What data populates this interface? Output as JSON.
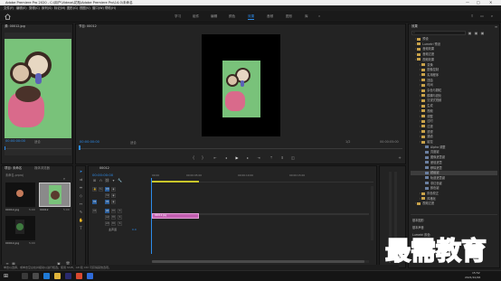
{
  "app": {
    "title": "Adobe Premiere Pro 2020 - C:\\用户\\Videos\\花瓶\\Adobe Premiere Pro\\14.0\\未命名",
    "window_controls": [
      "—",
      "□",
      "✕"
    ]
  },
  "menu": [
    "文件(F)",
    "编辑(E)",
    "剪辑(C)",
    "序列(S)",
    "标记(M)",
    "图形(G)",
    "视图(V)",
    "窗口(W)",
    "帮助(H)"
  ],
  "workspaces": {
    "home_icon": "home-icon",
    "tabs": [
      "学习",
      "组件",
      "编辑",
      "颜色",
      "效果",
      "音频",
      "图形",
      "库"
    ],
    "active": "效果"
  },
  "source_monitor": {
    "tab": "源: 00012.jpg",
    "timecode": "00:00:00:00",
    "zoom": "适合"
  },
  "program_monitor": {
    "tab": "节目: 00012",
    "timecode": "00:00:00:00",
    "zoom": "适合",
    "quality": "1/2",
    "duration": "00:00:05:00"
  },
  "project_panel": {
    "tab": "项目: 未命名",
    "tab2": "媒体浏览器",
    "project_file": "未命名.prproj",
    "items": [
      {
        "name": "00012.jpg",
        "meta": "5:00"
      },
      {
        "name": "00012",
        "meta": "5:00"
      },
      {
        "name": "00012.jpg",
        "meta": "5:00"
      }
    ]
  },
  "timeline": {
    "tab": "00012",
    "timecode": "00:00:00:00",
    "ruler": [
      "00:00",
      "00:00:05:00",
      "00:00:10:00",
      "00:00:15:00"
    ],
    "video_tracks": [
      "V3",
      "V2",
      "V1"
    ],
    "audio_tracks": [
      "A1",
      "A2",
      "A3"
    ],
    "master": "主声道",
    "master_value": "0.0",
    "clip": "00012.jpg"
  },
  "effects_panel": {
    "tab": "效果",
    "tree": [
      {
        "label": "预设",
        "indent": 1,
        "kind": "folder"
      },
      {
        "label": "Lumetri 预设",
        "indent": 1,
        "kind": "folder"
      },
      {
        "label": "音频效果",
        "indent": 1,
        "kind": "folder"
      },
      {
        "label": "音频过渡",
        "indent": 1,
        "kind": "folder"
      },
      {
        "label": "视频效果",
        "indent": 1,
        "kind": "folder"
      },
      {
        "label": "变换",
        "indent": 2,
        "kind": "folder"
      },
      {
        "label": "图像控制",
        "indent": 2,
        "kind": "folder"
      },
      {
        "label": "实用程序",
        "indent": 2,
        "kind": "folder"
      },
      {
        "label": "扭曲",
        "indent": 2,
        "kind": "folder"
      },
      {
        "label": "时间",
        "indent": 2,
        "kind": "folder"
      },
      {
        "label": "杂色与颗粒",
        "indent": 2,
        "kind": "folder"
      },
      {
        "label": "模糊与锐化",
        "indent": 2,
        "kind": "folder"
      },
      {
        "label": "沉浸式视频",
        "indent": 2,
        "kind": "folder"
      },
      {
        "label": "生成",
        "indent": 2,
        "kind": "folder"
      },
      {
        "label": "视频",
        "indent": 2,
        "kind": "folder"
      },
      {
        "label": "调整",
        "indent": 2,
        "kind": "folder"
      },
      {
        "label": "过时",
        "indent": 2,
        "kind": "folder"
      },
      {
        "label": "过渡",
        "indent": 2,
        "kind": "folder"
      },
      {
        "label": "透视",
        "indent": 2,
        "kind": "folder"
      },
      {
        "label": "通道",
        "indent": 2,
        "kind": "folder"
      },
      {
        "label": "键控",
        "indent": 2,
        "kind": "folder"
      },
      {
        "label": "Alpha 调整",
        "indent": 3,
        "kind": "fx"
      },
      {
        "label": "亮度键",
        "indent": 3,
        "kind": "fx"
      },
      {
        "label": "图像遮罩键",
        "indent": 3,
        "kind": "fx"
      },
      {
        "label": "差值遮罩",
        "indent": 3,
        "kind": "fx"
      },
      {
        "label": "移除遮罩",
        "indent": 3,
        "kind": "fx"
      },
      {
        "label": "超级键",
        "indent": 3,
        "kind": "fx",
        "selected": true
      },
      {
        "label": "轨道遮罩键",
        "indent": 3,
        "kind": "fx"
      },
      {
        "label": "非红色键",
        "indent": 3,
        "kind": "fx"
      },
      {
        "label": "颜色键",
        "indent": 3,
        "kind": "fx"
      },
      {
        "label": "颜色校正",
        "indent": 2,
        "kind": "folder"
      },
      {
        "label": "风格化",
        "indent": 2,
        "kind": "folder"
      },
      {
        "label": "视频过渡",
        "indent": 1,
        "kind": "folder"
      }
    ],
    "sections": [
      "基本图形",
      "基本声音",
      "Lumetri 颜色",
      "库",
      "标记"
    ]
  },
  "status_bar": "单击以选择，或单击空白处并拖动以进行框选。使用 Shift、Alt 和 Ctrl 可获得其他选项。",
  "watermark": "最需教育",
  "taskbar": {
    "time": "15:52",
    "date": "2021/10/26"
  },
  "colors": {
    "accent": "#2d8ceb",
    "clip": "#c25fb0",
    "green_bg": "#79c27a"
  }
}
